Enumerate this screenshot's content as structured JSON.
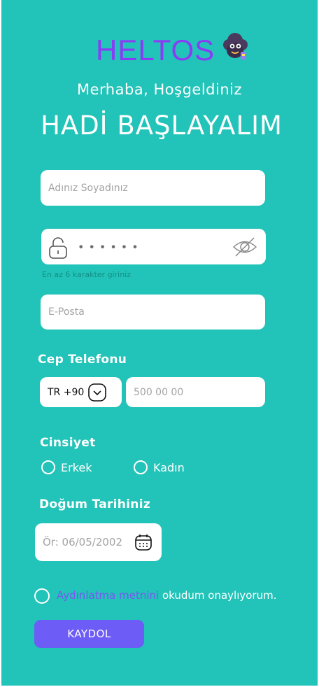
{
  "brand": {
    "name": "HELTOS",
    "mascot_icon": "sheep-mascot-icon"
  },
  "header": {
    "welcome": "Merhaba, Hoşgeldiniz",
    "headline": "HADİ BAŞLAYALIM"
  },
  "form": {
    "name": {
      "placeholder": "Adınız Soyadınız"
    },
    "password": {
      "masked_value": "••••••",
      "hint": "En az 6 karakter giriniz",
      "lock_icon": "lock-icon",
      "visibility_icon": "eye-off-icon"
    },
    "email": {
      "placeholder": "E-Posta"
    },
    "phone": {
      "label": "Cep Telefonu",
      "country_code": "TR +90",
      "placeholder": "500 00 00"
    },
    "gender": {
      "label": "Cinsiyet",
      "options": [
        "Erkek",
        "Kadın"
      ]
    },
    "birthdate": {
      "label": "Doğum Tarihiniz",
      "placeholder": "Ör: 06/05/2002"
    },
    "consent": {
      "link_text": "Aydınlatma metnini",
      "rest_text": " okudum onaylıyorum."
    },
    "submit_label": "KAYDOL"
  },
  "colors": {
    "background": "#22c3b8",
    "brand": "#8a3cf5",
    "button": "#6d5cf6",
    "link": "#7b56f2"
  }
}
